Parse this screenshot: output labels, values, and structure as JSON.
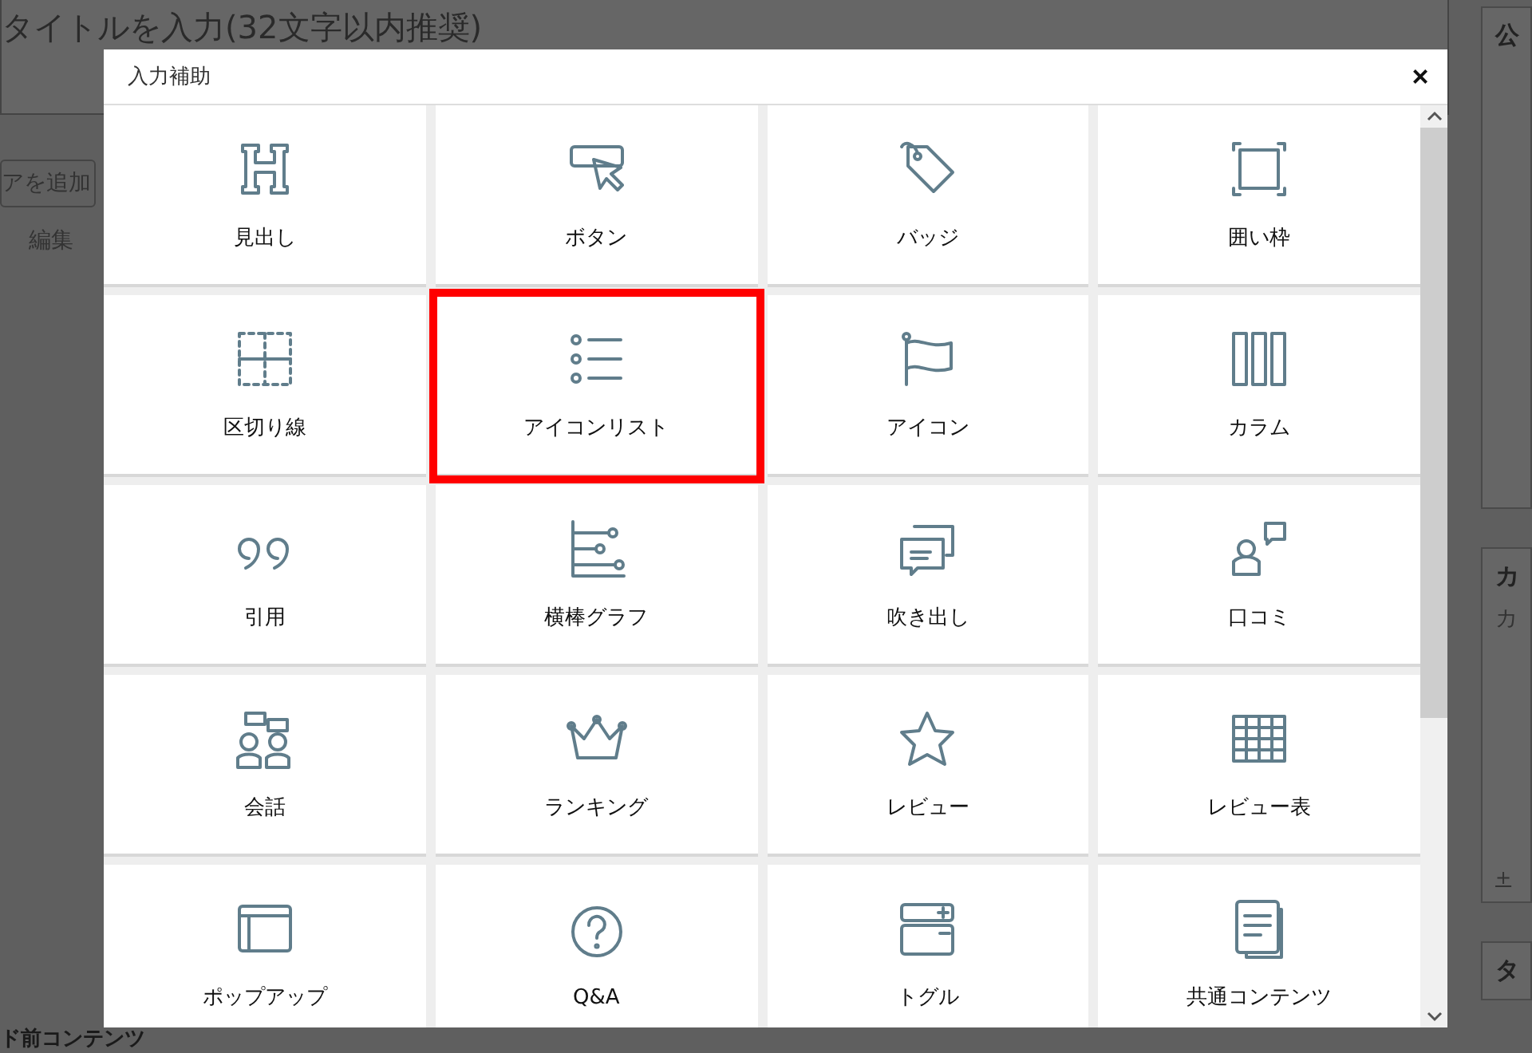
{
  "editor": {
    "title_placeholder": "タイトルを入力(32文字以内推奨)",
    "media_button": "アを追加",
    "menu": "編集",
    "bottom_section": "ド前コンテンツ"
  },
  "sidebar": {
    "panels": [
      "公",
      "カ",
      "タ"
    ],
    "category_label": "カ",
    "add_link": "+"
  },
  "modal": {
    "title": "入力補助",
    "close": "×",
    "items": [
      {
        "label": "見出し",
        "selected": false
      },
      {
        "label": "ボタン",
        "selected": false
      },
      {
        "label": "バッジ",
        "selected": false
      },
      {
        "label": "囲い枠",
        "selected": false
      },
      {
        "label": "区切り線",
        "selected": false
      },
      {
        "label": "アイコンリスト",
        "selected": true
      },
      {
        "label": "アイコン",
        "selected": false
      },
      {
        "label": "カラム",
        "selected": false
      },
      {
        "label": "引用",
        "selected": false
      },
      {
        "label": "横棒グラフ",
        "selected": false
      },
      {
        "label": "吹き出し",
        "selected": false
      },
      {
        "label": "口コミ",
        "selected": false
      },
      {
        "label": "会話",
        "selected": false
      },
      {
        "label": "ランキング",
        "selected": false
      },
      {
        "label": "レビュー",
        "selected": false
      },
      {
        "label": "レビュー表",
        "selected": false
      },
      {
        "label": "ポップアップ",
        "selected": false
      },
      {
        "label": "Q&A",
        "selected": false
      },
      {
        "label": "トグル",
        "selected": false
      },
      {
        "label": "共通コンテンツ",
        "selected": false
      }
    ]
  }
}
